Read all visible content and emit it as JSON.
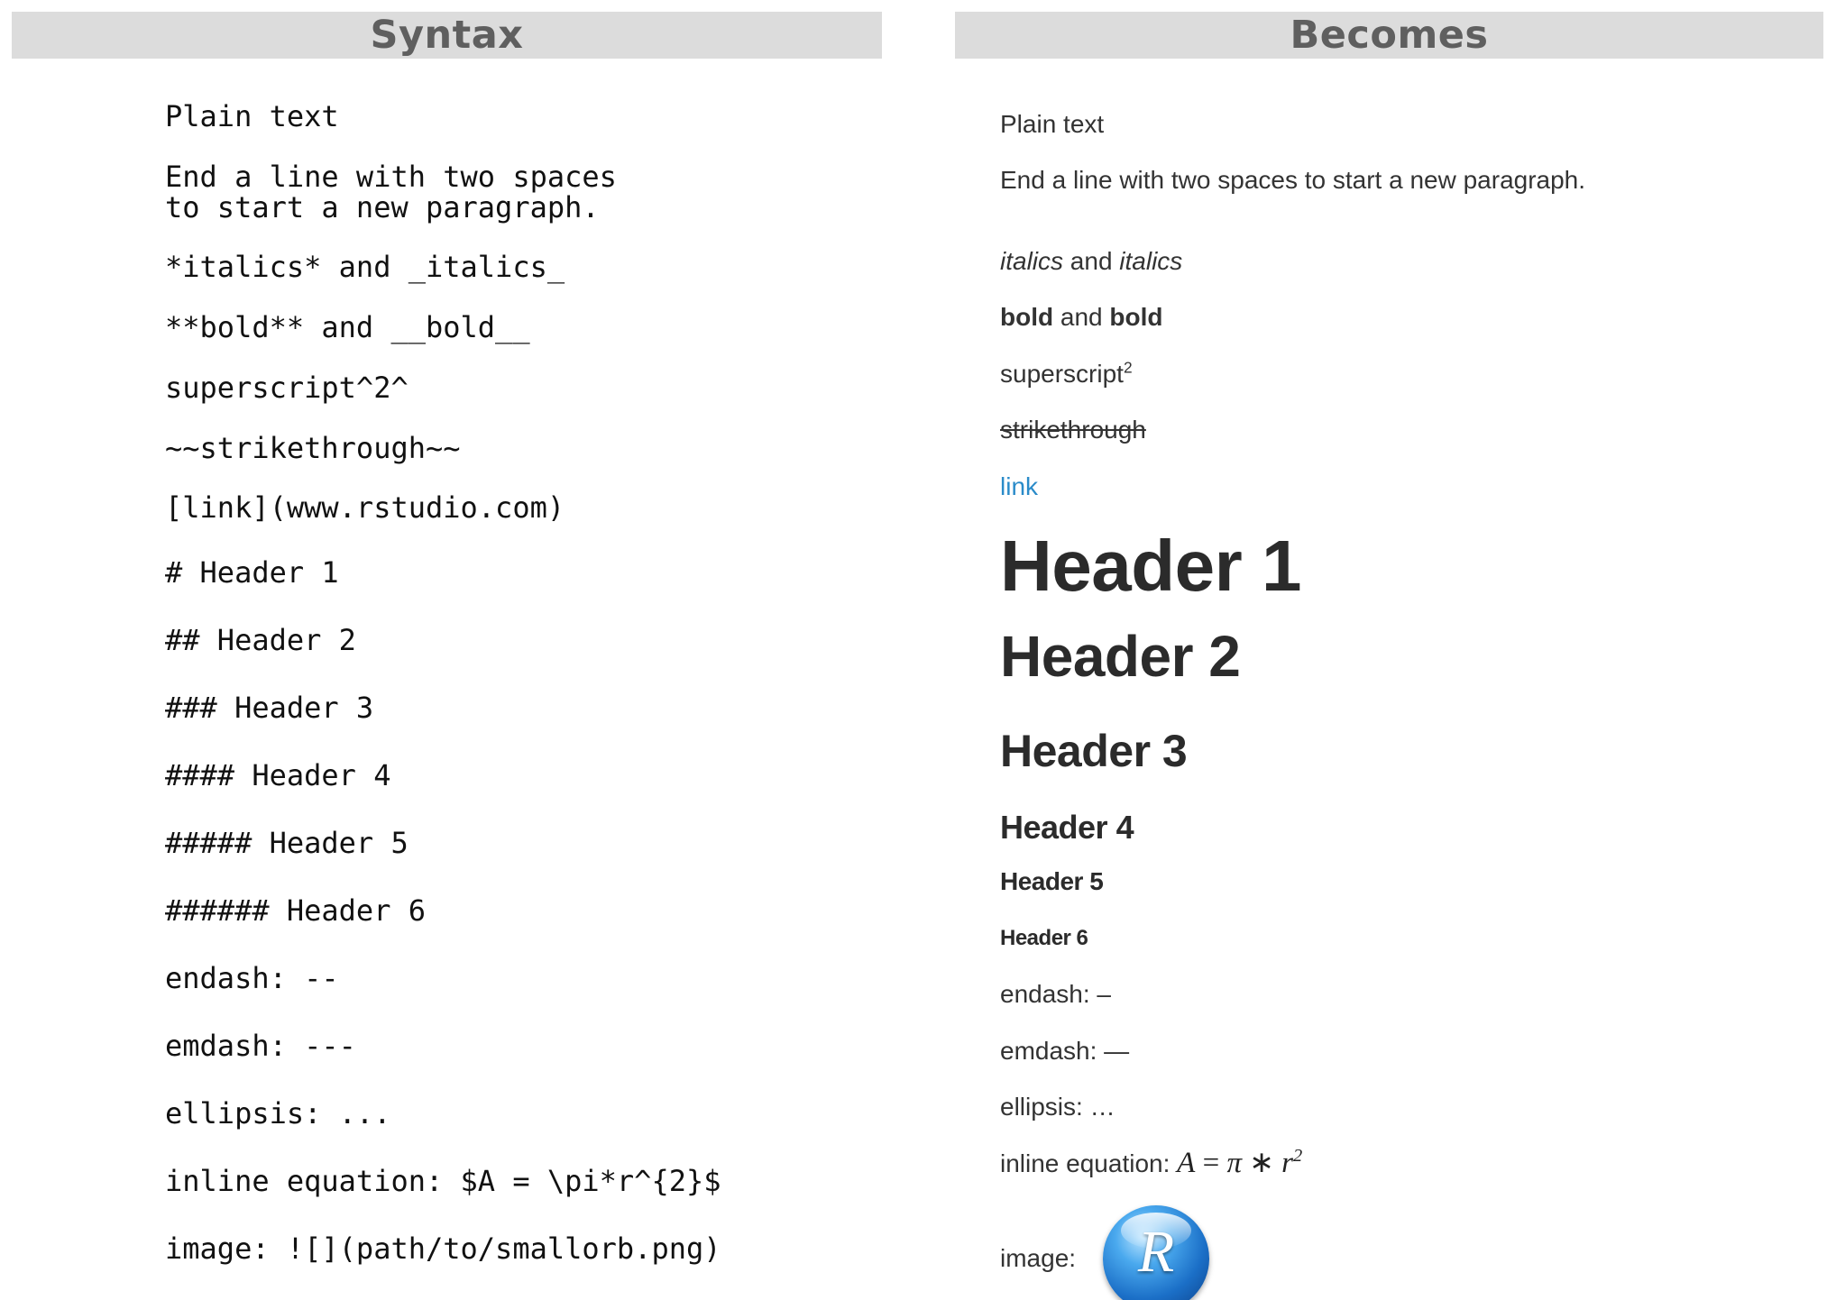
{
  "headers": {
    "syntax": "Syntax",
    "becomes": "Becomes"
  },
  "syntax": {
    "plain": "Plain text",
    "endline_1": "End a line with two spaces",
    "endline_2": "to start a new paragraph.",
    "italics": "*italics* and _italics_",
    "bold": "**bold** and __bold__",
    "superscript": "superscript^2^",
    "strikethrough": "~~strikethrough~~",
    "link": "[link](www.rstudio.com)",
    "h1": "# Header 1",
    "h2": "## Header 2",
    "h3": "### Header 3",
    "h4": "#### Header 4",
    "h5": "##### Header 5",
    "h6": "###### Header 6",
    "endash": "endash: --",
    "emdash": "emdash: ---",
    "ellipsis": "ellipsis: ...",
    "equation": "inline equation: $A = \\pi*r^{2}$",
    "image": "image: ![](path/to/smallorb.png)"
  },
  "rendered": {
    "plain": "Plain text",
    "endline": "End a line with two spaces to start a new paragraph.",
    "italics_1": "italics",
    "and_1": " and ",
    "italics_2": "italics",
    "bold_1": "bold",
    "and_2": " and ",
    "bold_2": "bold",
    "superscript_base": "superscript",
    "superscript_sup": "2",
    "strikethrough": "strikethrough",
    "link": "link",
    "h1": "Header 1",
    "h2": "Header 2",
    "h3": "Header 3",
    "h4": "Header 4",
    "h5": "Header 5",
    "h6": "Header 6",
    "endash": "endash: –",
    "emdash": "emdash: —",
    "ellipsis": "ellipsis: …",
    "equation_label": "inline equation: ",
    "eq_A": "A",
    "eq_eq": " = ",
    "eq_pi": "π",
    "eq_times": " ∗ ",
    "eq_r": "r",
    "eq_exp": "2",
    "image_label": "image:",
    "orb_letter": "R"
  },
  "colors": {
    "header_bar": "#dcdcdc",
    "header_text": "#5f5f5f",
    "link": "#2a8bc9"
  }
}
